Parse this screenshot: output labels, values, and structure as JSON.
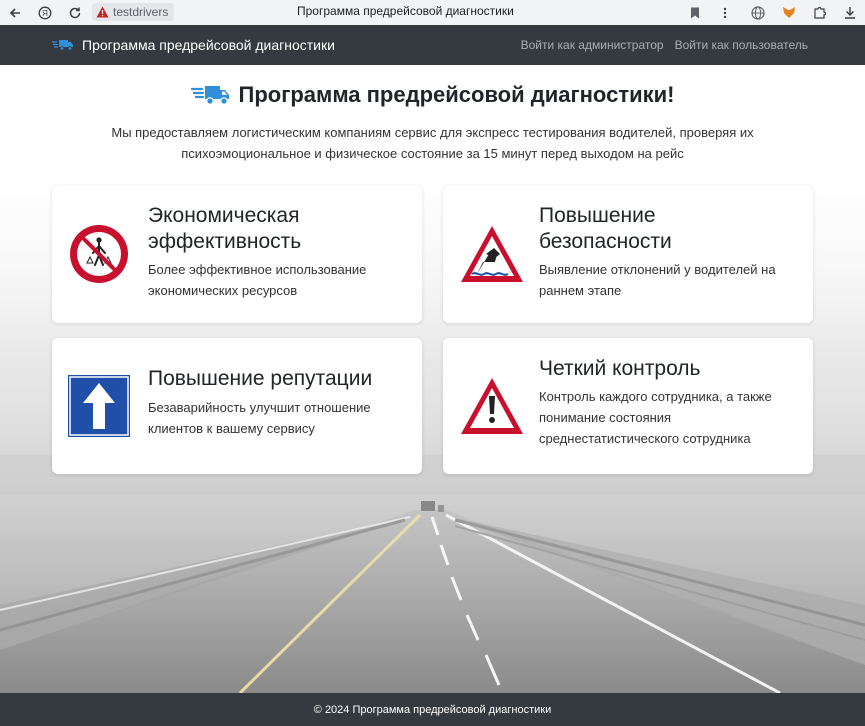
{
  "browser": {
    "site_chip": "testdrivers",
    "tab_title": "Программа предрейсовой диагностики"
  },
  "navbar": {
    "brand": "Программа предрейсовой диагностики",
    "links": [
      "Войти как администратор",
      "Войти как пользователь"
    ]
  },
  "hero": {
    "title": "Программа предрейсовой диагностики!",
    "lead": "Мы предоставляем логистическим компаниям сервис для экспресс тестирования водителей, проверяя их психоэмоциональное и физическое состояние за 15 минут перед выходом на рейс"
  },
  "cards": [
    {
      "title": "Экономическая эффективность",
      "text": "Более эффективное использование экономических ресурсов",
      "icon": "no-pedestrians-sign-icon"
    },
    {
      "title": "Повышение безопасности",
      "text": "Выявление отклонений у водителей на раннем этапе",
      "icon": "embankment-warning-sign-icon"
    },
    {
      "title": "Повышение репутации",
      "text": "Безаварийность улучшит отношение клиентов к вашему сервису",
      "icon": "one-way-sign-icon"
    },
    {
      "title": "Четкий контроль",
      "text": "Контроль каждого сотрудника, а также понимание состояния среднестатистического сотрудника",
      "icon": "exclamation-warning-sign-icon"
    }
  ],
  "footer": {
    "text": "© 2024 Программа предрейсовой диагностики"
  },
  "colors": {
    "navbar": "#343a40",
    "truck_blue": "#2f8fd8",
    "sign_red": "#c8102e",
    "sign_blue": "#1f4fa8"
  }
}
